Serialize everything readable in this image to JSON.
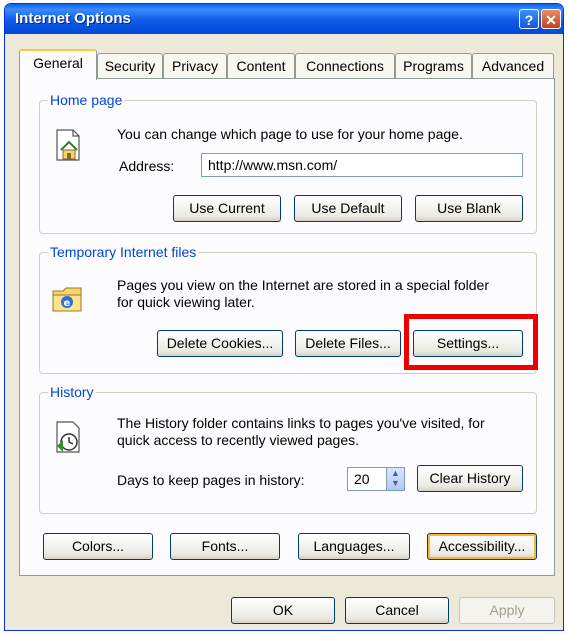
{
  "window": {
    "title": "Internet Options"
  },
  "tabs": [
    "General",
    "Security",
    "Privacy",
    "Content",
    "Connections",
    "Programs",
    "Advanced"
  ],
  "home_page": {
    "legend": "Home page",
    "description": "You can change which page to use for your home page.",
    "address_label": "Address:",
    "address_value": "http://www.msn.com/",
    "buttons": {
      "use_current": "Use Current",
      "use_default": "Use Default",
      "use_blank": "Use Blank"
    }
  },
  "temp_files": {
    "legend": "Temporary Internet files",
    "description_line1": "Pages you view on the Internet are stored in a special folder",
    "description_line2": "for quick viewing later.",
    "buttons": {
      "delete_cookies": "Delete Cookies...",
      "delete_files": "Delete Files...",
      "settings": "Settings..."
    }
  },
  "history": {
    "legend": "History",
    "description_line1": "The History folder contains links to pages you've visited, for",
    "description_line2": "quick access to recently viewed pages.",
    "days_label": "Days to keep pages in history:",
    "days_value": "20",
    "clear_button": "Clear History"
  },
  "bottom_buttons": {
    "colors": "Colors...",
    "fonts": "Fonts...",
    "languages": "Languages...",
    "accessibility": "Accessibility..."
  },
  "dialog_buttons": {
    "ok": "OK",
    "cancel": "Cancel",
    "apply": "Apply"
  },
  "colors": {
    "title_bar": "#0A5FEF",
    "dialog_bg": "#ECE9D8",
    "group_title": "#0046D5",
    "highlight": "#EE0000"
  }
}
